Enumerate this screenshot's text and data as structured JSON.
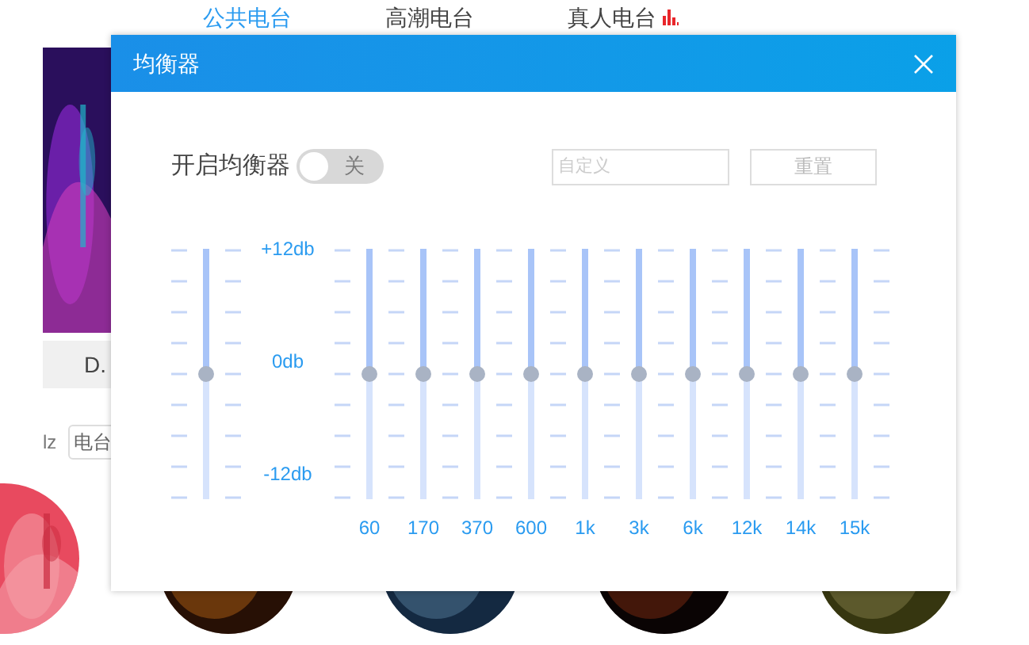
{
  "tabs": [
    {
      "label": "公共电台",
      "selected": true,
      "playing": false
    },
    {
      "label": "高潮电台",
      "selected": false,
      "playing": false
    },
    {
      "label": "真人电台",
      "selected": false,
      "playing": true
    }
  ],
  "background": {
    "card_label": "D.",
    "filter_label": "lz",
    "filter_field": {
      "value": "电台"
    }
  },
  "dialog": {
    "title": "均衡器",
    "enable_label": "开启均衡器",
    "switch": {
      "label": "关",
      "on": false
    },
    "preset_field": {
      "placeholder": "自定义"
    },
    "reset_button": "重置",
    "preamp": {
      "level": 0.5
    },
    "scale_labels": [
      "+12db",
      "0db",
      "-12db"
    ],
    "bands": [
      {
        "label": "60",
        "level": 0.5
      },
      {
        "label": "170",
        "level": 0.5
      },
      {
        "label": "370",
        "level": 0.5
      },
      {
        "label": "600",
        "level": 0.5
      },
      {
        "label": "1k",
        "level": 0.5
      },
      {
        "label": "3k",
        "level": 0.5
      },
      {
        "label": "6k",
        "level": 0.5
      },
      {
        "label": "12k",
        "level": 0.5
      },
      {
        "label": "14k",
        "level": 0.5
      },
      {
        "label": "15k",
        "level": 0.5
      }
    ]
  }
}
